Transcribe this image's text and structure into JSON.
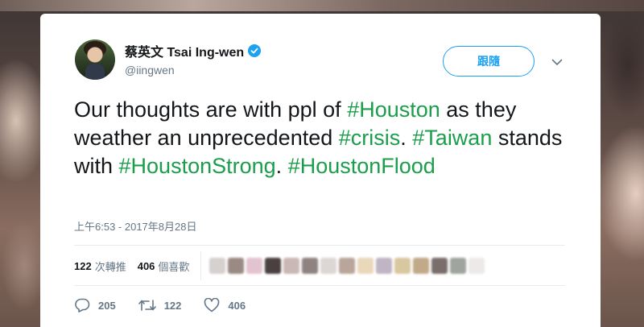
{
  "tweet": {
    "author": {
      "display_name": "蔡英文 Tsai Ing-wen",
      "handle": "@iingwen",
      "verified": true,
      "avatar_icon": "profile-photo"
    },
    "follow_label": "跟隨",
    "text_segments": [
      {
        "text": "Our thoughts are with ppl of ",
        "hashtag": false
      },
      {
        "text": "#Houston",
        "hashtag": true
      },
      {
        "text": " as they weather an unprecedented ",
        "hashtag": false
      },
      {
        "text": "#crisis",
        "hashtag": true
      },
      {
        "text": ". ",
        "hashtag": false
      },
      {
        "text": "#Taiwan",
        "hashtag": true
      },
      {
        "text": " stands with ",
        "hashtag": false
      },
      {
        "text": "#HoustonStrong",
        "hashtag": true
      },
      {
        "text": ". ",
        "hashtag": false
      },
      {
        "text": "#HoustonFlood",
        "hashtag": true
      }
    ],
    "timestamp": "上午6:53 - 2017年8月28日",
    "stats": {
      "retweets_count": "122",
      "retweets_label": "次轉推",
      "likes_count": "406",
      "likes_label": "個喜歡"
    },
    "liker_avatars_blurred": [
      "#d6d0cf",
      "#9b8a84",
      "#e3c3cf",
      "#4a4040",
      "#c9b8b3",
      "#8e8380",
      "#dcd7d5",
      "#b9a59a",
      "#e9d8b9",
      "#bfb5c4",
      "#d8c8a0",
      "#c2a988",
      "#7a6e6a",
      "#a0a49e",
      "#ede9e8"
    ],
    "actions": {
      "reply_count": "205",
      "retweet_count": "122",
      "like_count": "406"
    }
  },
  "colors": {
    "hashtag": "#1b9e4b",
    "accent": "#1da1f2",
    "secondary_text": "#657786"
  }
}
